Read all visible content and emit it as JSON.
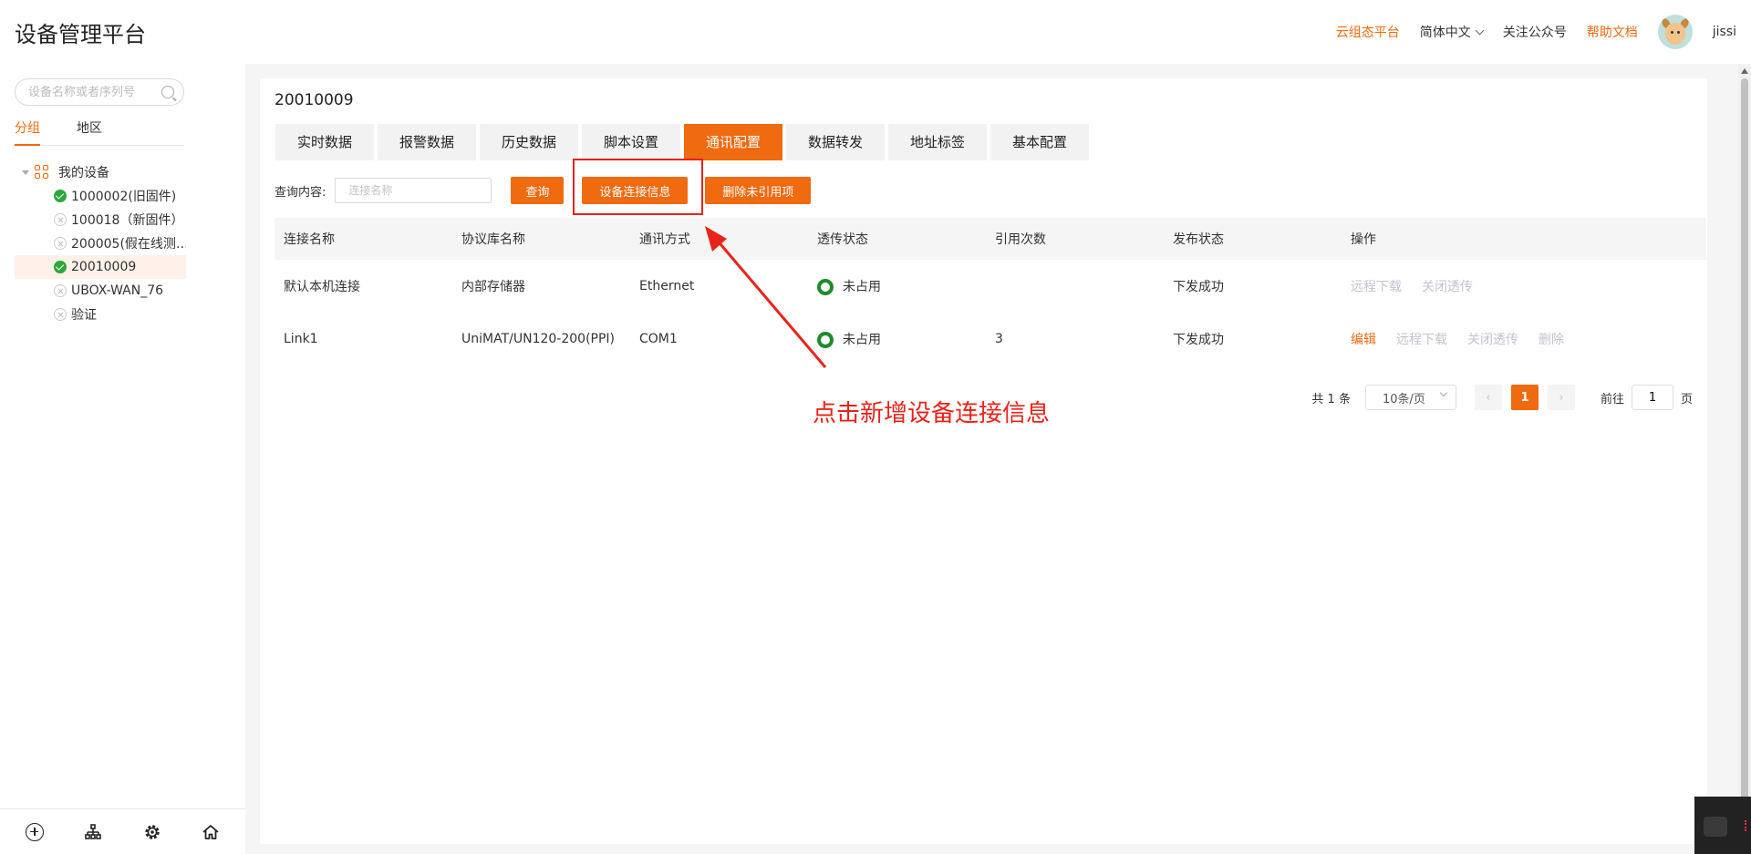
{
  "header": {
    "title": "设备管理平台",
    "links": {
      "cloud": "云组态平台",
      "language": "简体中文",
      "follow": "关注公众号",
      "help": "帮助文档"
    },
    "username": "jissi"
  },
  "sidebar": {
    "search_placeholder": "设备名称或者序列号",
    "tabs": [
      "分组",
      "地区"
    ],
    "root": "我的设备",
    "devices": [
      {
        "name": "1000002(旧固件)",
        "status": "online"
      },
      {
        "name": "100018（新固件）",
        "status": "offline"
      },
      {
        "name": "200005(假在线测…",
        "status": "offline"
      },
      {
        "name": "20010009",
        "status": "online",
        "selected": true
      },
      {
        "name": "UBOX-WAN_76",
        "status": "offline"
      },
      {
        "name": "验证",
        "status": "offline"
      }
    ],
    "footer_icons": [
      "add-circle-icon",
      "org-tree-icon",
      "settings-gear-icon",
      "home-icon"
    ]
  },
  "main": {
    "device_title": "20010009",
    "tabs": [
      "实时数据",
      "报警数据",
      "历史数据",
      "脚本设置",
      "通讯配置",
      "数据转发",
      "地址标签",
      "基本配置"
    ],
    "active_tab": "通讯配置",
    "query": {
      "label": "查询内容:",
      "placeholder": "连接名称",
      "search_btn": "查询",
      "device_conn_btn": "设备连接信息",
      "delete_btn": "删除未引用项"
    },
    "table": {
      "headers": [
        "连接名称",
        "协议库名称",
        "通讯方式",
        "透传状态",
        "引用次数",
        "发布状态",
        "操作"
      ],
      "rows": [
        {
          "name": "默认本机连接",
          "protocol": "内部存储器",
          "comm": "Ethernet",
          "passthrough": "未占用",
          "refs": "",
          "publish": "下发成功",
          "ops": [
            "远程下载",
            "关闭透传"
          ]
        },
        {
          "name": "Link1",
          "protocol": "UniMAT/UN120-200(PPI)",
          "comm": "COM1",
          "passthrough": "未占用",
          "refs": "3",
          "publish": "下发成功",
          "ops": [
            "编辑",
            "远程下载",
            "关闭透传",
            "删除"
          ]
        }
      ]
    },
    "pagination": {
      "total": "共 1 条",
      "page_size": "10条/页",
      "current": "1",
      "goto_label": "前往",
      "goto_value": "1",
      "page_suffix": "页"
    },
    "annotation": "点击新增设备连接信息"
  },
  "colors": {
    "accent": "#f06a0f",
    "annotation": "#e8231a",
    "online": "#2aa83a",
    "ring": "#1f8a2a"
  }
}
